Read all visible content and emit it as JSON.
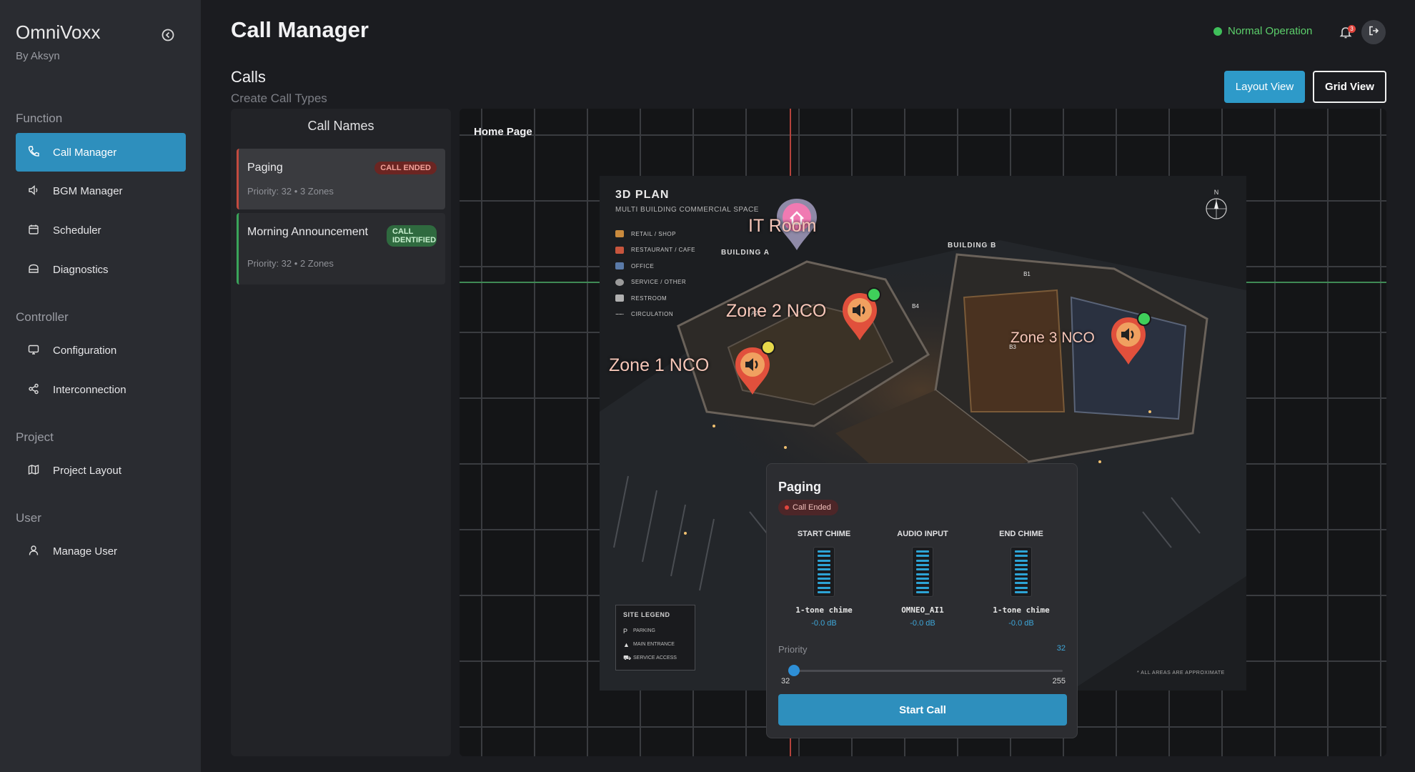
{
  "app": {
    "name": "OmniVoxx",
    "subtitle": "By Aksyn"
  },
  "sidebar": {
    "sections": [
      {
        "title": "Function",
        "items": [
          {
            "label": "Call Manager",
            "icon": "phone-icon",
            "active": true
          },
          {
            "label": "BGM Manager",
            "icon": "speaker-icon"
          },
          {
            "label": "Scheduler",
            "icon": "calendar-icon"
          },
          {
            "label": "Diagnostics",
            "icon": "diagnostics-icon"
          }
        ]
      },
      {
        "title": "Controller",
        "items": [
          {
            "label": "Configuration",
            "icon": "monitor-icon"
          },
          {
            "label": "Interconnection",
            "icon": "share-icon"
          }
        ]
      },
      {
        "title": "Project",
        "items": [
          {
            "label": "Project Layout",
            "icon": "map-icon"
          }
        ]
      },
      {
        "title": "User",
        "items": [
          {
            "label": "Manage User",
            "icon": "user-icon"
          }
        ]
      }
    ]
  },
  "header": {
    "title": "Call Manager",
    "status": "Normal Operation",
    "notification_count": "3"
  },
  "calls": {
    "title": "Calls",
    "subtitle": "Create Call Types",
    "layout_view_label": "Layout View",
    "grid_view_label": "Grid View"
  },
  "call_names": {
    "title": "Call Names",
    "items": [
      {
        "name": "Paging",
        "badge": "CALL ENDED",
        "priority": "Priority: 32",
        "zones": "3 Zones"
      },
      {
        "name": "Morning Announcement",
        "badge": "CALL IDENTIFIED",
        "priority": "Priority: 32",
        "zones": "2 Zones"
      }
    ]
  },
  "map": {
    "page_label": "Home Page",
    "plan_title": "3D PLAN",
    "plan_subtitle": "MULTI BUILDING COMMERCIAL SPACE",
    "legend": [
      "RETAIL / SHOP",
      "RESTAURANT / CAFE",
      "OFFICE",
      "SERVICE / OTHER",
      "RESTROOM",
      "CIRCULATION"
    ],
    "compass": "N",
    "buildings": [
      "BUILDING A",
      "BUILDING B"
    ],
    "zones": [
      "IT Room",
      "Zone 2 NCO",
      "Zone 1 NCO",
      "Zone 3 NCO"
    ],
    "site_legend": {
      "title": "SITE LEGEND",
      "items": [
        {
          "key": "P",
          "label": "PARKING"
        },
        {
          "key": "▲",
          "label": "MAIN ENTRANCE"
        },
        {
          "key": "⛟",
          "label": "SERVICE ACCESS"
        }
      ]
    },
    "approx_note": "* ALL AREAS ARE APPROXIMATE"
  },
  "popup": {
    "title": "Paging",
    "status": "Call Ended",
    "columns": [
      {
        "title": "START CHIME",
        "name": "1-tone chime",
        "db": "-0.0 dB"
      },
      {
        "title": "AUDIO INPUT",
        "name": "OMNEO_AI1",
        "db": "-0.0 dB"
      },
      {
        "title": "END CHIME",
        "name": "1-tone chime",
        "db": "-0.0 dB"
      }
    ],
    "priority_label": "Priority",
    "priority_value": "32",
    "priority_min": "32",
    "priority_max": "255",
    "start_label": "Start Call"
  }
}
